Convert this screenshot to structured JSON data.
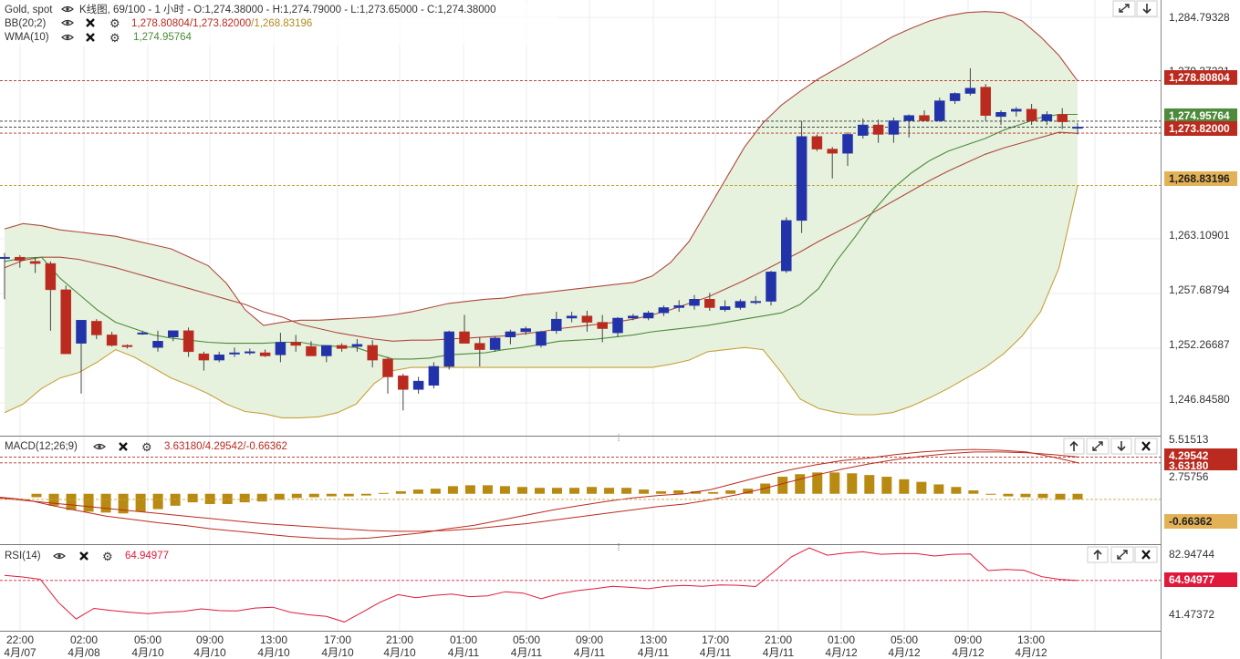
{
  "main": {
    "title_symbol": "Gold, spot",
    "title_info": "K线图, 69/100 - 1 小时 - O:1,274.38000 - H:1,274.79000 - L:1,273.65000 - C:1,274.38000",
    "bb_label": "BB(20;2)",
    "bb_upper": "1,278.80804",
    "bb_mid": "1,273.82000",
    "bb_lower": "1,268.83196",
    "wma_label": "WMA(10)",
    "wma_value": "1,274.95764",
    "y_ticks": [
      "1,284.79328",
      "1,263.10901",
      "1,257.68794",
      "1,252.26687",
      "1,246.84580"
    ],
    "y_tick_partial": "1,279.37221",
    "tags": {
      "bb_upper": "1,278.80804",
      "wma": "1,274.95764",
      "bb_mid": "1,273.82000",
      "bb_lower": "1,268.83196"
    },
    "colors": {
      "bull": "#2233aa",
      "bear": "#bb2a1e",
      "band_fill": "#e6f2de",
      "band_line": "#b0493e",
      "lower_line": "#c7a13a",
      "wma": "#4d8a3a"
    }
  },
  "macd": {
    "label": "MACD(12;26;9)",
    "value_text": "3.63180/4.29542/-0.66362",
    "y_ticks": [
      "5.51513",
      "2.75756"
    ],
    "tags": {
      "signal": "4.29542",
      "macd": "3.63180",
      "hist": "-0.66362"
    }
  },
  "rsi": {
    "label": "RSI(14)",
    "value_text": "64.94977",
    "y_ticks": [
      "82.94744",
      "41.47372"
    ],
    "tag": "64.94977"
  },
  "x_axis": {
    "times": [
      "22:00",
      "02:00",
      "05:00",
      "09:00",
      "13:00",
      "17:00",
      "21:00",
      "01:00",
      "05:00",
      "09:00",
      "13:00",
      "17:00",
      "21:00",
      "01:00",
      "05:00",
      "09:00",
      "13:00"
    ],
    "dates": [
      "4月/07",
      "4月/08",
      "4月/10",
      "4月/10",
      "4月/10",
      "4月/10",
      "4月/10",
      "4月/11",
      "4月/11",
      "4月/11",
      "4月/11",
      "4月/11",
      "4月/11",
      "4月/12",
      "4月/12",
      "4月/12",
      "4月/12"
    ]
  },
  "chart_data": [
    {
      "type": "candlestick",
      "ylim": [
        1245.0,
        1286.5
      ],
      "series": [
        {
          "name": "BB(20;2) upper",
          "values": [
            1264.7,
            1265.2,
            1265.0,
            1264.6,
            1264.4,
            1264.2,
            1264.0,
            1263.6,
            1263.2,
            1262.8,
            1262.0,
            1261.2,
            1259.5,
            1257.0,
            1255.5,
            1255.8,
            1256.0,
            1256.0,
            1256.1,
            1256.2,
            1256.3,
            1256.5,
            1256.8,
            1257.2,
            1257.6,
            1257.8,
            1258.0,
            1258.1,
            1258.4,
            1258.6,
            1258.8,
            1259.0,
            1259.2,
            1259.4,
            1259.6,
            1260.2,
            1261.5,
            1263.5,
            1266.5,
            1269.5,
            1272.5,
            1274.8,
            1276.5,
            1277.8,
            1279.0,
            1280.0,
            1281.0,
            1282.0,
            1283.0,
            1283.8,
            1284.5,
            1285.0,
            1285.3,
            1285.4,
            1285.3,
            1284.5,
            1283.0,
            1281.2,
            1278.8
          ]
        },
        {
          "name": "BB(20;2) middle",
          "values": [
            1261.0,
            1261.7,
            1262.0,
            1262.0,
            1261.8,
            1261.4,
            1261.0,
            1260.5,
            1260.0,
            1259.5,
            1259.0,
            1258.5,
            1258.0,
            1257.5,
            1256.8,
            1256.3,
            1255.6,
            1255.2,
            1254.8,
            1254.5,
            1254.2,
            1254.0,
            1254.1,
            1254.1,
            1254.2,
            1254.3,
            1254.4,
            1254.5,
            1254.7,
            1254.9,
            1255.2,
            1255.4,
            1255.6,
            1255.8,
            1256.1,
            1256.5,
            1257.0,
            1257.6,
            1258.2,
            1259.0,
            1259.8,
            1260.7,
            1261.6,
            1262.5,
            1263.5,
            1264.4,
            1265.3,
            1266.3,
            1267.3,
            1268.3,
            1269.3,
            1270.2,
            1271.0,
            1271.8,
            1272.4,
            1272.9,
            1273.4,
            1273.9,
            1273.8
          ]
        },
        {
          "name": "BB(20;2) lower",
          "values": [
            1247.2,
            1248.0,
            1249.5,
            1250.5,
            1251.0,
            1252.0,
            1253.2,
            1252.5,
            1251.5,
            1250.5,
            1249.8,
            1249.0,
            1248.0,
            1247.3,
            1247.1,
            1246.7,
            1246.7,
            1246.8,
            1247.2,
            1248.0,
            1250.0,
            1251.2,
            1251.5,
            1251.5,
            1251.5,
            1251.5,
            1251.5,
            1251.5,
            1251.5,
            1251.5,
            1251.5,
            1251.5,
            1251.5,
            1251.5,
            1251.5,
            1251.5,
            1251.8,
            1252.2,
            1253.0,
            1253.2,
            1253.4,
            1253.2,
            1251.0,
            1248.5,
            1247.6,
            1247.2,
            1247.0,
            1247.0,
            1247.2,
            1247.8,
            1248.6,
            1249.5,
            1250.5,
            1251.5,
            1252.8,
            1254.5,
            1256.8,
            1261.0,
            1268.8
          ]
        },
        {
          "name": "WMA(10)",
          "values": [
            1261.6,
            1261.9,
            1262.0,
            1260.0,
            1258.5,
            1257.0,
            1255.8,
            1255.2,
            1254.6,
            1254.3,
            1254.1,
            1253.9,
            1253.8,
            1253.8,
            1253.8,
            1253.9,
            1253.9,
            1253.6,
            1253.5,
            1253.4,
            1252.8,
            1252.3,
            1252.3,
            1252.4,
            1252.7,
            1252.8,
            1252.9,
            1253.2,
            1253.4,
            1253.7,
            1254.0,
            1254.1,
            1254.2,
            1254.4,
            1254.6,
            1254.9,
            1255.1,
            1255.3,
            1255.5,
            1255.8,
            1256.1,
            1256.4,
            1256.7,
            1257.5,
            1259.0,
            1261.7,
            1264.0,
            1266.5,
            1268.5,
            1270.0,
            1271.2,
            1272.1,
            1272.7,
            1273.3,
            1274.1,
            1274.7,
            1275.3,
            1275.6,
            1275.6
          ]
        }
      ],
      "candles": [
        {
          "o": 1262.0,
          "h": 1262.4,
          "l": 1258.0,
          "c": 1262.0
        },
        {
          "o": 1262.0,
          "h": 1262.2,
          "l": 1261.0,
          "c": 1261.7
        },
        {
          "o": 1261.6,
          "h": 1262.0,
          "l": 1260.5,
          "c": 1261.4
        },
        {
          "o": 1261.4,
          "h": 1261.6,
          "l": 1255.0,
          "c": 1258.9
        },
        {
          "o": 1258.9,
          "h": 1259.3,
          "l": 1252.8,
          "c": 1252.8
        },
        {
          "o": 1253.8,
          "h": 1255.2,
          "l": 1249.0,
          "c": 1256.0
        },
        {
          "o": 1255.9,
          "h": 1256.1,
          "l": 1254.2,
          "c": 1254.6
        },
        {
          "o": 1254.6,
          "h": 1254.9,
          "l": 1253.5,
          "c": 1253.6
        },
        {
          "o": 1253.6,
          "h": 1253.7,
          "l": 1253.3,
          "c": 1253.5
        },
        {
          "o": 1254.8,
          "h": 1255.0,
          "l": 1254.6,
          "c": 1254.8
        },
        {
          "o": 1253.4,
          "h": 1255.0,
          "l": 1253.0,
          "c": 1254.0
        },
        {
          "o": 1254.4,
          "h": 1255.0,
          "l": 1254.0,
          "c": 1255.0
        },
        {
          "o": 1255.0,
          "h": 1255.3,
          "l": 1252.5,
          "c": 1253.0
        },
        {
          "o": 1252.8,
          "h": 1253.0,
          "l": 1251.2,
          "c": 1252.2
        },
        {
          "o": 1252.2,
          "h": 1253.0,
          "l": 1252.0,
          "c": 1252.7
        },
        {
          "o": 1252.9,
          "h": 1253.4,
          "l": 1252.5,
          "c": 1252.9
        },
        {
          "o": 1252.9,
          "h": 1253.3,
          "l": 1252.7,
          "c": 1253.0
        },
        {
          "o": 1252.9,
          "h": 1253.2,
          "l": 1252.5,
          "c": 1252.6
        },
        {
          "o": 1252.7,
          "h": 1254.8,
          "l": 1252.0,
          "c": 1253.9
        },
        {
          "o": 1253.9,
          "h": 1254.6,
          "l": 1253.0,
          "c": 1253.6
        },
        {
          "o": 1253.5,
          "h": 1254.0,
          "l": 1252.6,
          "c": 1252.6
        },
        {
          "o": 1252.6,
          "h": 1253.6,
          "l": 1252.0,
          "c": 1253.6
        },
        {
          "o": 1253.6,
          "h": 1253.8,
          "l": 1253.0,
          "c": 1253.3
        },
        {
          "o": 1253.5,
          "h": 1254.2,
          "l": 1253.0,
          "c": 1253.7
        },
        {
          "o": 1253.6,
          "h": 1254.1,
          "l": 1251.5,
          "c": 1252.2
        },
        {
          "o": 1252.3,
          "h": 1252.5,
          "l": 1249.0,
          "c": 1250.6
        },
        {
          "o": 1250.7,
          "h": 1250.9,
          "l": 1247.4,
          "c": 1249.4
        },
        {
          "o": 1249.4,
          "h": 1250.6,
          "l": 1249.0,
          "c": 1250.2
        },
        {
          "o": 1249.8,
          "h": 1252.0,
          "l": 1249.5,
          "c": 1251.6
        },
        {
          "o": 1251.6,
          "h": 1255.0,
          "l": 1251.3,
          "c": 1254.9
        },
        {
          "o": 1254.9,
          "h": 1256.5,
          "l": 1253.8,
          "c": 1253.8
        },
        {
          "o": 1253.8,
          "h": 1254.4,
          "l": 1251.6,
          "c": 1253.2
        },
        {
          "o": 1253.2,
          "h": 1254.5,
          "l": 1253.0,
          "c": 1254.3
        },
        {
          "o": 1254.4,
          "h": 1255.1,
          "l": 1253.7,
          "c": 1254.9
        },
        {
          "o": 1254.9,
          "h": 1255.4,
          "l": 1254.6,
          "c": 1255.2
        },
        {
          "o": 1253.6,
          "h": 1255.0,
          "l": 1253.4,
          "c": 1254.9
        },
        {
          "o": 1255.0,
          "h": 1256.8,
          "l": 1254.7,
          "c": 1256.1
        },
        {
          "o": 1256.2,
          "h": 1256.8,
          "l": 1255.8,
          "c": 1256.4
        },
        {
          "o": 1256.4,
          "h": 1256.9,
          "l": 1254.9,
          "c": 1255.8
        },
        {
          "o": 1255.8,
          "h": 1256.5,
          "l": 1253.9,
          "c": 1255.2
        },
        {
          "o": 1254.8,
          "h": 1256.3,
          "l": 1254.4,
          "c": 1256.2
        },
        {
          "o": 1256.2,
          "h": 1256.6,
          "l": 1256.0,
          "c": 1256.4
        },
        {
          "o": 1256.2,
          "h": 1256.9,
          "l": 1256.0,
          "c": 1256.7
        },
        {
          "o": 1256.7,
          "h": 1257.4,
          "l": 1256.4,
          "c": 1257.2
        },
        {
          "o": 1257.2,
          "h": 1257.9,
          "l": 1256.8,
          "c": 1257.4
        },
        {
          "o": 1257.4,
          "h": 1258.4,
          "l": 1257.0,
          "c": 1258.0
        },
        {
          "o": 1258.0,
          "h": 1258.6,
          "l": 1256.9,
          "c": 1257.2
        },
        {
          "o": 1257.0,
          "h": 1257.9,
          "l": 1256.8,
          "c": 1257.3
        },
        {
          "o": 1257.2,
          "h": 1258.0,
          "l": 1257.0,
          "c": 1257.8
        },
        {
          "o": 1257.8,
          "h": 1258.3,
          "l": 1257.5,
          "c": 1257.8
        },
        {
          "o": 1257.8,
          "h": 1260.7,
          "l": 1257.4,
          "c": 1260.6
        },
        {
          "o": 1260.7,
          "h": 1265.8,
          "l": 1260.5,
          "c": 1265.5
        },
        {
          "o": 1265.5,
          "h": 1275.0,
          "l": 1264.3,
          "c": 1273.5
        },
        {
          "o": 1273.5,
          "h": 1273.7,
          "l": 1272.1,
          "c": 1272.3
        },
        {
          "o": 1272.3,
          "h": 1272.5,
          "l": 1269.5,
          "c": 1271.9
        },
        {
          "o": 1271.9,
          "h": 1273.9,
          "l": 1270.7,
          "c": 1273.7
        },
        {
          "o": 1273.6,
          "h": 1275.2,
          "l": 1273.3,
          "c": 1274.6
        },
        {
          "o": 1274.6,
          "h": 1275.1,
          "l": 1272.9,
          "c": 1273.7
        },
        {
          "o": 1273.7,
          "h": 1275.3,
          "l": 1272.9,
          "c": 1275.0
        },
        {
          "o": 1275.0,
          "h": 1275.6,
          "l": 1273.4,
          "c": 1275.5
        },
        {
          "o": 1275.5,
          "h": 1276.0,
          "l": 1275.1,
          "c": 1275.0
        },
        {
          "o": 1275.0,
          "h": 1277.2,
          "l": 1274.9,
          "c": 1276.9
        },
        {
          "o": 1276.9,
          "h": 1277.7,
          "l": 1276.6,
          "c": 1277.6
        },
        {
          "o": 1277.6,
          "h": 1280.0,
          "l": 1277.4,
          "c": 1278.1
        },
        {
          "o": 1278.2,
          "h": 1278.5,
          "l": 1275.0,
          "c": 1275.5
        },
        {
          "o": 1275.4,
          "h": 1276.0,
          "l": 1274.6,
          "c": 1275.8
        },
        {
          "o": 1275.9,
          "h": 1276.3,
          "l": 1275.4,
          "c": 1276.1
        },
        {
          "o": 1276.1,
          "h": 1276.6,
          "l": 1274.6,
          "c": 1275.0
        },
        {
          "o": 1275.0,
          "h": 1275.9,
          "l": 1274.6,
          "c": 1275.6
        },
        {
          "o": 1275.6,
          "h": 1276.2,
          "l": 1274.2,
          "c": 1274.9
        },
        {
          "o": 1274.4,
          "h": 1274.8,
          "l": 1273.7,
          "c": 1274.4
        }
      ]
    },
    {
      "type": "bar",
      "title": "MACD(12;26;9)",
      "ylim": [
        -5.8,
        6.6
      ],
      "series": [
        {
          "name": "MACD",
          "values": [
            -0.4,
            -0.7,
            -1.4,
            -2.0,
            -2.6,
            -3.0,
            -3.4,
            -3.7,
            -4.1,
            -4.4,
            -4.7,
            -5.0,
            -5.2,
            -5.3,
            -5.2,
            -4.9,
            -4.6,
            -4.1,
            -3.7,
            -3.1,
            -2.5,
            -1.9,
            -1.4,
            -0.9,
            -0.5,
            -0.2,
            0.0,
            0.5,
            1.3,
            2.1,
            2.8,
            3.4,
            3.9,
            4.2,
            4.6,
            4.9,
            5.1,
            5.2,
            5.1,
            4.9,
            4.3,
            3.6
          ]
        },
        {
          "name": "Signal",
          "values": [
            -0.5,
            -0.8,
            -1.1,
            -1.4,
            -1.7,
            -2.0,
            -2.3,
            -2.6,
            -2.9,
            -3.2,
            -3.5,
            -3.7,
            -3.9,
            -4.1,
            -4.3,
            -4.4,
            -4.4,
            -4.3,
            -4.1,
            -3.8,
            -3.5,
            -3.1,
            -2.7,
            -2.3,
            -1.9,
            -1.5,
            -1.2,
            -0.7,
            -0.1,
            0.6,
            1.4,
            2.2,
            2.9,
            3.5,
            4.0,
            4.4,
            4.7,
            4.9,
            4.9,
            4.8,
            4.6,
            4.3
          ]
        },
        {
          "name": "Histogram",
          "values": [
            -0.4,
            -1.4,
            -1.9,
            -2.1,
            -2.2,
            -2.3,
            -2.1,
            -1.8,
            -1.4,
            -1.0,
            -1.2,
            -1.2,
            -1.0,
            -0.9,
            -0.7,
            -0.5,
            -0.4,
            -0.3,
            -0.3,
            -0.2,
            0.1,
            0.3,
            0.5,
            0.6,
            0.9,
            1.0,
            1.0,
            0.9,
            0.8,
            0.7,
            0.7,
            0.7,
            0.8,
            0.7,
            0.7,
            0.5,
            0.3,
            0.4,
            0.3,
            0.2,
            0.4,
            0.6,
            1.2,
            2.0,
            2.3,
            2.5,
            2.5,
            2.4,
            2.2,
            2.0,
            1.7,
            1.4,
            1.1,
            0.8,
            0.4,
            -0.1,
            -0.3,
            -0.4,
            -0.5,
            -0.7,
            -0.66
          ]
        }
      ]
    },
    {
      "type": "line",
      "title": "RSI(14)",
      "ylim": [
        35.0,
        86.0
      ],
      "series": [
        {
          "name": "RSI(14)",
          "values": [
            68.0,
            67.0,
            65.6,
            52.0,
            42.0,
            48.3,
            47.0,
            46.0,
            45.2,
            46.0,
            46.5,
            48.0,
            47.0,
            46.8,
            48.5,
            49.0,
            46.0,
            44.5,
            43.5,
            40.2,
            46.0,
            52.0,
            56.5,
            54.7,
            56.0,
            56.8,
            55.3,
            55.8,
            58.2,
            57.4,
            54.1,
            57.0,
            58.8,
            60.0,
            61.5,
            60.8,
            60.0,
            61.4,
            62.0,
            61.5,
            62.3,
            62.1,
            61.3,
            70.0,
            79.0,
            84.3,
            80.0,
            81.2,
            82.0,
            80.5,
            80.9,
            80.9,
            79.5,
            80.5,
            80.7,
            70.8,
            71.5,
            71.0,
            67.2,
            65.6,
            64.9
          ]
        }
      ]
    }
  ]
}
